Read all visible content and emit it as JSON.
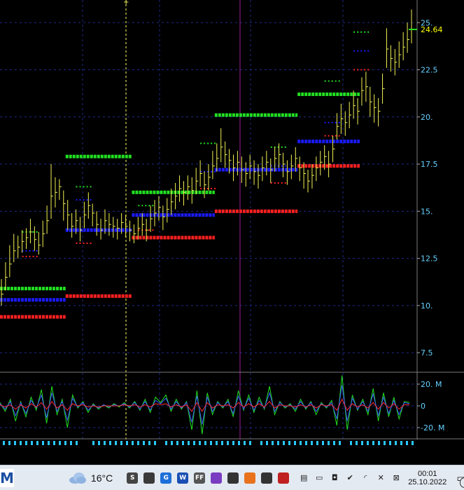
{
  "chart_data": [
    {
      "type": "line",
      "y_axis_side": "right",
      "yticks": [
        7.5,
        10,
        12.5,
        15,
        17.5,
        20,
        22.5,
        25
      ],
      "ytick_labels": [
        "7.5",
        "10.",
        "12.5",
        "15.",
        "17.5",
        "20.",
        "22.5",
        "25."
      ],
      "ylim": [
        6.5,
        26.2
      ],
      "last_price": 24.64,
      "last_price_label": "24.64",
      "price_bars": {
        "close": [
          10.6,
          11.5,
          12.2,
          12.9,
          13.1,
          13.4,
          13.6,
          13.9,
          13.5,
          13.2,
          13.8,
          14.5,
          15.8,
          16.0,
          16.3,
          15.4,
          14.8,
          14.2,
          14.5,
          14.0,
          14.8,
          15.3,
          14.9,
          14.3,
          14.0,
          14.5,
          14.3,
          14.2,
          14.1,
          14.4,
          14.2,
          14.0,
          13.8,
          14.1,
          14.3,
          14.0,
          14.6,
          14.9,
          15.2,
          14.7,
          15.1,
          15.5,
          15.8,
          16.2,
          16.0,
          16.3,
          16.1,
          16.6,
          17.0,
          16.4,
          16.8,
          17.4,
          17.8,
          18.4,
          18.0,
          17.7,
          17.3,
          17.6,
          17.2,
          17.0,
          17.4,
          17.1,
          16.9,
          17.3,
          17.6,
          17.2,
          17.8,
          18.0,
          17.5,
          17.1,
          17.4,
          17.8,
          17.3,
          17.0,
          16.6,
          16.9,
          17.3,
          17.6,
          17.9,
          17.5,
          18.3,
          19.5,
          19.9,
          19.7,
          20.1,
          20.6,
          20.3,
          21.4,
          21.6,
          20.8,
          20.5,
          20.3,
          21.5,
          23.6,
          23.1,
          22.9,
          23.3,
          23.7,
          24.1,
          24.64
        ],
        "high": [
          11.4,
          12.3,
          13.2,
          13.8,
          13.7,
          14.0,
          14.1,
          14.6,
          14.2,
          13.9,
          14.5,
          15.3,
          17.5,
          16.8,
          16.7,
          16.1,
          15.6,
          14.9,
          15.1,
          14.7,
          15.5,
          16.0,
          15.4,
          15.0,
          14.6,
          15.1,
          14.9,
          14.7,
          14.6,
          14.9,
          14.8,
          14.5,
          14.3,
          14.7,
          14.9,
          14.6,
          15.3,
          15.6,
          15.8,
          15.3,
          15.7,
          16.2,
          16.5,
          16.9,
          16.6,
          16.9,
          16.8,
          17.3,
          17.7,
          17.1,
          17.5,
          18.2,
          18.6,
          19.4,
          18.7,
          18.3,
          18.0,
          18.2,
          17.9,
          17.6,
          18.0,
          17.7,
          17.5,
          17.9,
          18.2,
          17.8,
          18.4,
          18.6,
          18.1,
          17.7,
          18.0,
          18.4,
          17.9,
          17.6,
          17.2,
          17.5,
          17.9,
          18.2,
          18.5,
          18.2,
          19.0,
          20.2,
          20.7,
          20.3,
          20.8,
          21.4,
          21.0,
          22.1,
          22.4,
          21.6,
          21.2,
          21.0,
          22.3,
          24.7,
          23.8,
          23.6,
          24.0,
          24.5,
          25.0,
          25.7
        ],
        "low": [
          10.0,
          10.8,
          11.5,
          12.3,
          12.5,
          12.8,
          13.0,
          13.3,
          12.9,
          12.7,
          13.1,
          13.8,
          14.6,
          15.2,
          15.6,
          14.5,
          14.0,
          13.6,
          13.8,
          13.4,
          14.1,
          14.6,
          14.2,
          13.7,
          13.5,
          13.8,
          13.7,
          13.6,
          13.5,
          13.8,
          13.6,
          13.4,
          13.3,
          13.5,
          13.7,
          13.4,
          13.9,
          14.2,
          14.5,
          14.0,
          14.4,
          14.8,
          15.1,
          15.5,
          15.3,
          15.6,
          15.4,
          15.9,
          16.3,
          15.7,
          16.1,
          16.7,
          17.1,
          17.6,
          17.3,
          17.0,
          16.6,
          16.9,
          16.5,
          16.3,
          16.7,
          16.4,
          16.2,
          16.6,
          16.9,
          16.5,
          17.1,
          17.3,
          16.8,
          16.4,
          16.7,
          17.1,
          16.6,
          16.2,
          16.0,
          16.2,
          16.6,
          16.9,
          17.2,
          16.8,
          17.6,
          18.8,
          19.1,
          19.0,
          19.4,
          19.9,
          19.6,
          20.6,
          20.8,
          20.0,
          19.7,
          19.5,
          20.7,
          22.6,
          22.4,
          22.2,
          22.6,
          23.0,
          23.4,
          23.9
        ]
      },
      "levels": [
        {
          "color": "#22e022",
          "segments": [
            [
              10.9,
              0,
              16
            ],
            [
              17.9,
              16,
              32
            ],
            [
              16.0,
              32,
              52
            ],
            [
              20.1,
              52,
              72
            ],
            [
              21.2,
              72,
              87
            ]
          ]
        },
        {
          "color": "#1a1aff",
          "segments": [
            [
              10.3,
              0,
              16
            ],
            [
              14.0,
              16,
              32
            ],
            [
              14.8,
              32,
              52
            ],
            [
              17.2,
              52,
              72
            ],
            [
              18.7,
              72,
              87
            ]
          ]
        },
        {
          "color": "#ff2020",
          "segments": [
            [
              9.4,
              0,
              16
            ],
            [
              10.5,
              16,
              32
            ],
            [
              13.6,
              32,
              52
            ],
            [
              15.0,
              52,
              72
            ],
            [
              17.4,
              72,
              87
            ]
          ]
        }
      ],
      "dashed_levels": [
        {
          "color": "#22e022",
          "value": 13.9,
          "i0": 5,
          "i1": 9
        },
        {
          "color": "#1a1aff",
          "value": 12.9,
          "i0": 5,
          "i1": 9
        },
        {
          "color": "#ff2020",
          "value": 12.6,
          "i0": 5,
          "i1": 9
        },
        {
          "color": "#22e022",
          "value": 16.3,
          "i0": 18,
          "i1": 22
        },
        {
          "color": "#1a1aff",
          "value": 15.6,
          "i0": 18,
          "i1": 22
        },
        {
          "color": "#ff2020",
          "value": 13.3,
          "i0": 18,
          "i1": 22
        },
        {
          "color": "#22e022",
          "value": 15.3,
          "i0": 33,
          "i1": 37
        },
        {
          "color": "#ff2020",
          "value": 14.0,
          "i0": 33,
          "i1": 37
        },
        {
          "color": "#22e022",
          "value": 18.6,
          "i0": 48,
          "i1": 52
        },
        {
          "color": "#1a1aff",
          "value": 17.1,
          "i0": 48,
          "i1": 52
        },
        {
          "color": "#ff2020",
          "value": 16.2,
          "i0": 48,
          "i1": 52
        },
        {
          "color": "#22e022",
          "value": 18.4,
          "i0": 65,
          "i1": 69
        },
        {
          "color": "#1a1aff",
          "value": 17.4,
          "i0": 65,
          "i1": 69
        },
        {
          "color": "#ff2020",
          "value": 16.5,
          "i0": 65,
          "i1": 69
        },
        {
          "color": "#22e022",
          "value": 21.9,
          "i0": 78,
          "i1": 82
        },
        {
          "color": "#1a1aff",
          "value": 19.7,
          "i0": 78,
          "i1": 82
        },
        {
          "color": "#ff2020",
          "value": 19.0,
          "i0": 78,
          "i1": 82
        },
        {
          "color": "#22e022",
          "value": 24.5,
          "i0": 85,
          "i1": 89
        },
        {
          "color": "#1a1aff",
          "value": 23.5,
          "i0": 85,
          "i1": 89
        },
        {
          "color": "#ff2020",
          "value": 22.5,
          "i0": 85,
          "i1": 89
        }
      ],
      "colors": {
        "price": "#f2f252",
        "grid": "#1e2a8a",
        "axis_text": "#66d0ff",
        "last_price_text": "#ffff00",
        "cursor": "#ffff66",
        "marker": "#9a1e9a"
      }
    },
    {
      "type": "line",
      "y_axis_side": "right",
      "yticks": [
        20,
        0,
        -20
      ],
      "ytick_labels": [
        "20. M",
        "0",
        "-20. M"
      ],
      "ylim": [
        -29,
        29
      ],
      "series": [
        {
          "color": "#22e022",
          "values": [
            3,
            -5,
            6,
            -14,
            4,
            -10,
            8,
            -4,
            15,
            -16,
            18,
            -8,
            6,
            -20,
            10,
            -2,
            4,
            -6,
            2,
            -3,
            1,
            -2,
            2,
            -1,
            3,
            -2,
            4,
            -4,
            6,
            -6,
            8,
            3,
            10,
            -5,
            6,
            -3,
            4,
            -22,
            14,
            -26,
            12,
            -8,
            4,
            -2,
            6,
            -10,
            14,
            -4,
            10,
            -6,
            8,
            -3,
            18,
            -8,
            4,
            -2,
            2,
            -5,
            6,
            -3,
            4,
            -8,
            3,
            -2,
            5,
            -18,
            28,
            -22,
            10,
            -4,
            6,
            -8,
            16,
            -14,
            12,
            -10,
            8,
            -12,
            4,
            3
          ]
        },
        {
          "color": "#3a58ff",
          "values": [
            2,
            -3,
            4,
            -9,
            3,
            -7,
            5,
            -2,
            10,
            -11,
            12,
            -5,
            4,
            -13,
            7,
            -1,
            3,
            -4,
            1,
            -2,
            1,
            -1,
            1,
            0,
            2,
            -1,
            3,
            -3,
            4,
            -4,
            5,
            2,
            7,
            -3,
            4,
            -2,
            3,
            -15,
            9,
            -17,
            8,
            -5,
            3,
            -1,
            4,
            -7,
            9,
            -3,
            7,
            -4,
            5,
            -2,
            12,
            -5,
            3,
            -1,
            1,
            -3,
            4,
            -2,
            3,
            -5,
            2,
            -1,
            3,
            -12,
            19,
            -14,
            7,
            -3,
            4,
            -5,
            11,
            -9,
            8,
            -7,
            5,
            -8,
            3,
            2
          ]
        },
        {
          "color": "#ff3030",
          "values": [
            1,
            -1,
            1,
            -3,
            1,
            -2,
            2,
            -1,
            3,
            -3,
            4,
            -2,
            1,
            -4,
            2,
            0,
            1,
            -1,
            0,
            -1,
            0,
            0,
            0,
            0,
            1,
            0,
            1,
            -1,
            1,
            -1,
            2,
            1,
            2,
            -1,
            1,
            -1,
            1,
            -5,
            3,
            -5,
            3,
            -2,
            1,
            0,
            1,
            -2,
            3,
            -1,
            2,
            -1,
            2,
            -1,
            4,
            -2,
            1,
            0,
            0,
            -1,
            1,
            -1,
            1,
            -2,
            1,
            0,
            1,
            -4,
            6,
            -4,
            2,
            -1,
            1,
            -2,
            3,
            -3,
            3,
            -2,
            2,
            -3,
            1,
            1
          ]
        }
      ]
    }
  ],
  "taskbar": {
    "start_glyph": "M",
    "weather_temp": "16°C",
    "clock_time": "00:01",
    "clock_date": "25.10.2022",
    "notification_count": "5",
    "apps": [
      {
        "icon": "skype-icon",
        "letter": "S",
        "color": "#444444"
      },
      {
        "icon": "search-icon",
        "letter": "",
        "color": "#3a3a3a"
      },
      {
        "icon": "g-app-icon",
        "letter": "G",
        "color": "#1e6fd9"
      },
      {
        "icon": "w-app-icon",
        "letter": "W",
        "color": "#1a4fb3"
      },
      {
        "icon": "ff-app-icon",
        "letter": "FF",
        "color": "#555555"
      },
      {
        "icon": "feather-icon",
        "letter": "",
        "color": "#7a3cc0"
      },
      {
        "icon": "screen-capture-icon",
        "letter": "",
        "color": "#333333"
      },
      {
        "icon": "vlc-icon",
        "letter": "",
        "color": "#e8731c"
      },
      {
        "icon": "vpn-icon",
        "letter": "",
        "color": "#333333"
      },
      {
        "icon": "speaker-muted-icon",
        "letter": "",
        "color": "#c02020"
      }
    ],
    "tray": [
      {
        "icon": "document-icon",
        "glyph": "▤"
      },
      {
        "icon": "battery-icon",
        "glyph": "▭"
      },
      {
        "icon": "camera-icon",
        "glyph": "◘"
      },
      {
        "icon": "shield-check-icon",
        "glyph": "✔"
      },
      {
        "icon": "wifi-icon",
        "glyph": "◜"
      },
      {
        "icon": "volume-muted-icon",
        "glyph": "✕"
      },
      {
        "icon": "lock-icon",
        "glyph": "⊠"
      }
    ]
  }
}
